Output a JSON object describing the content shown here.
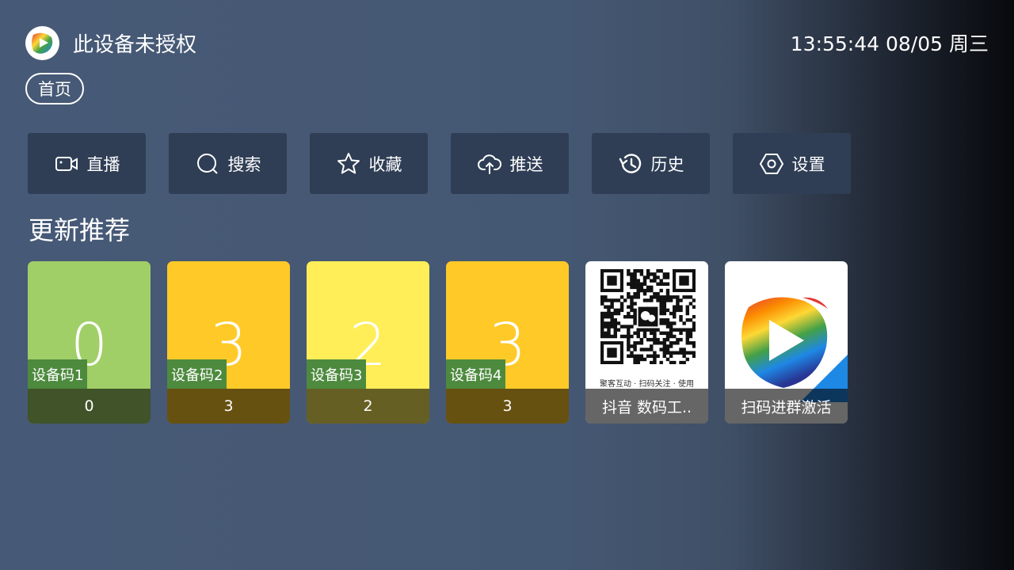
{
  "header": {
    "title": "此设备未授权",
    "clock": "13:55:44 08/05 周三",
    "logo_icon": "app-play-logo-icon"
  },
  "breadcrumb": {
    "label": "首页"
  },
  "menu": [
    {
      "label": "直播",
      "icon": "video-camera-icon"
    },
    {
      "label": "搜索",
      "icon": "search-icon"
    },
    {
      "label": "收藏",
      "icon": "star-icon"
    },
    {
      "label": "推送",
      "icon": "cloud-upload-icon"
    },
    {
      "label": "历史",
      "icon": "history-icon"
    },
    {
      "label": "设置",
      "icon": "settings-hexagon-icon"
    }
  ],
  "section": {
    "title": "更新推荐"
  },
  "cards": [
    {
      "big": "0",
      "tag": "设备码1",
      "footer": "0",
      "color": "#a0cf67"
    },
    {
      "big": "3",
      "tag": "设备码2",
      "footer": "3",
      "color": "#ffca28"
    },
    {
      "big": "2",
      "tag": "设备码3",
      "footer": "2",
      "color": "#ffee58"
    },
    {
      "big": "3",
      "tag": "设备码4",
      "footer": "3",
      "color": "#ffca28"
    },
    {
      "footer": "抖音 数码工..",
      "caption": "聚客互动 · 扫码关注 · 使用",
      "icon": "wechat-qr-code-icon"
    },
    {
      "footer": "扫码进群激活",
      "icon": "tv-play-logo-icon"
    }
  ]
}
